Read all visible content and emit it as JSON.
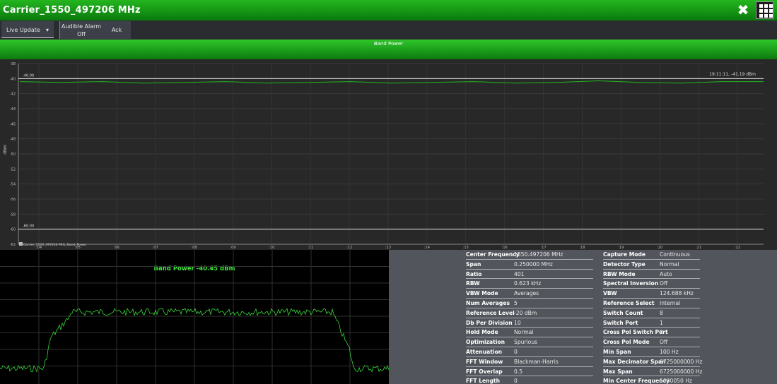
{
  "window": {
    "title": "Carrier_1550_497206 MHz"
  },
  "icons": {
    "close": "close-icon",
    "apps": "grid-menu-icon"
  },
  "toolbar": {
    "live_update_label": "Live Update",
    "alarm_label": "Audible Alarm",
    "alarm_value": "Off",
    "ack_label": "Ack"
  },
  "band_power_panel": {
    "title": "Band Power"
  },
  "trend_chart": {
    "ylabel": "dBm",
    "y_ticks": [
      "-38",
      "-40",
      "-42",
      "-44",
      "-46",
      "-48",
      "-50",
      "-52",
      "-54",
      "-56",
      "-58",
      "-60",
      "-62"
    ],
    "x_ticks": [
      ":04",
      ":05",
      ":06",
      ":07",
      ":08",
      ":09",
      ":10",
      ":11",
      ":12",
      ":13",
      ":14",
      ":15",
      ":16",
      ":17",
      ":18",
      ":19",
      ":20",
      ":21",
      ":22"
    ],
    "upper_limit_label": "-40.00",
    "lower_limit_label": "-60.00",
    "readout": "19:11:11, -41.19 dBm",
    "series_label": "Carrier_1550_497206 MHz_Band_Power"
  },
  "spectrum": {
    "band_power_label": "Band Power -40.45 dBm"
  },
  "chart_data": [
    {
      "type": "line",
      "ylabel": "dBm",
      "ylim": [
        -62,
        -38
      ],
      "x": [
        ":04",
        ":05",
        ":06",
        ":07",
        ":08",
        ":09",
        ":10",
        ":11",
        ":12",
        ":13",
        ":14",
        ":15",
        ":16",
        ":17",
        ":18",
        ":19",
        ":20",
        ":21",
        ":22"
      ],
      "series": [
        {
          "name": "Carrier_1550_497206 MHz_Band_Power",
          "values": [
            -40.4,
            -40.5,
            -40.4,
            -40.6,
            -40.5,
            -40.4,
            -40.6,
            -40.5,
            -40.4,
            -40.6,
            -40.5,
            -40.4,
            -40.6,
            -40.5,
            -40.3,
            -40.5,
            -40.6,
            -40.4,
            -40.4
          ]
        }
      ],
      "limits": [
        -40.0,
        -60.0
      ],
      "grid": true
    }
  ],
  "info_left": [
    {
      "k": "Center Frequency",
      "v": "1550.497206 MHz"
    },
    {
      "k": "Span",
      "v": "0.250000 MHz"
    },
    {
      "k": "Ratio",
      "v": "401"
    },
    {
      "k": "RBW",
      "v": "0.623 kHz"
    },
    {
      "k": "VBW Mode",
      "v": "Averages"
    },
    {
      "k": "Num Averages",
      "v": "5"
    },
    {
      "k": "Reference Level",
      "v": "-20 dBm"
    },
    {
      "k": "Db Per Division",
      "v": "10"
    },
    {
      "k": "Hold Mode",
      "v": "Normal"
    },
    {
      "k": "Optimization",
      "v": "Spurious"
    },
    {
      "k": "Attenuation",
      "v": "0"
    },
    {
      "k": "FFT Window",
      "v": "Blackman-Harris"
    },
    {
      "k": "FFT Overlap",
      "v": "0.5"
    },
    {
      "k": "FFT Length",
      "v": "0"
    }
  ],
  "info_right": [
    {
      "k": "Capture Mode",
      "v": "Continuous"
    },
    {
      "k": "Detector Type",
      "v": "Normal"
    },
    {
      "k": "RBW Mode",
      "v": "Auto"
    },
    {
      "k": "Spectral Inversion",
      "v": "Off"
    },
    {
      "k": "VBW",
      "v": "124.688 kHz"
    },
    {
      "k": "Reference Select",
      "v": "Internal"
    },
    {
      "k": "Switch Count",
      "v": "8"
    },
    {
      "k": "Switch Port",
      "v": "1"
    },
    {
      "k": "Cross Pol Switch Port",
      "v": "2"
    },
    {
      "k": "Cross Pol Mode",
      "v": "Off"
    },
    {
      "k": "Min Span",
      "v": "100 Hz"
    },
    {
      "k": "Max Decimator Span",
      "v": "6725000000 Hz"
    },
    {
      "k": "Max Span",
      "v": "6725000000 Hz"
    },
    {
      "k": "Min Center Frequency",
      "v": "5000050 Hz"
    }
  ]
}
